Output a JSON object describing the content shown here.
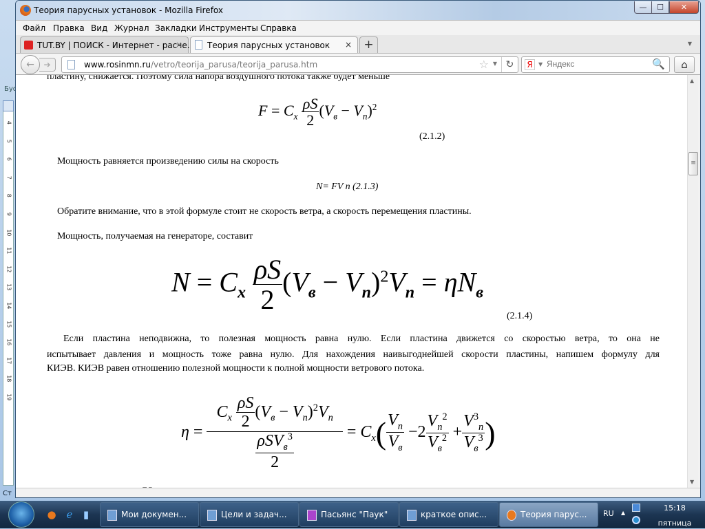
{
  "window": {
    "title": "Теория парусных установок - Mozilla Firefox",
    "minimize": "—",
    "maximize": "☐",
    "close": "✕"
  },
  "menu": [
    "Файл",
    "Правка",
    "Вид",
    "Журнал",
    "Закладки",
    "Инструменты",
    "Справка"
  ],
  "tabs": [
    {
      "label": "TUT.BY | ПОИСК - Интернет - расче...",
      "close": "×"
    },
    {
      "label": "Теория парусных установок",
      "close": "×"
    }
  ],
  "new_tab": "+",
  "nav": {
    "url_host": "www.rosinmn.ru",
    "url_path": "/vetro/teorija_parusa/teorija_parusa.htm",
    "search_placeholder": "Яндекс",
    "search_engine_logo": "Я"
  },
  "word_bg": {
    "ribbon_label": "Буф",
    "status_label": "Ст",
    "ruler": [
      "4",
      "5",
      "6",
      "7",
      "8",
      "9",
      "10",
      "11",
      "12",
      "13",
      "14",
      "15",
      "16",
      "17",
      "18",
      "19"
    ]
  },
  "article": {
    "line_top": "пластину, снижается. Поэтому сила напора воздушного потока также будет меньше",
    "eq_212_label": "(2.1.2)",
    "para_power": "Мощность равняется произведению силы на скорость",
    "eq_213": "N= FV n (2.1.3)",
    "para_note": "Обратите внимание, что в этой формуле стоит не скорость ветра, а скорость перемещения пластины.",
    "para_gen": "Мощность, получаемая на генераторе, составит",
    "eq_214_label": "(2.1.4)",
    "para_long": [
      "Если пластина неподвижна, то полезная мощность равна нулю. Если пластина движется со скоростью ветра, то она не",
      "испытывает давления и мощность тоже равна нулю. Для нахождения наивыгоднейшей скорости пластины, напишем формулу для",
      "КИЭВ. КИЭВ равен отношению полезной мощности к полной мощности ветрового потока."
    ],
    "eq": {
      "F": "F",
      "N": "N",
      "eta": "η",
      "C": "C",
      "x": "x",
      "rhoS": "ρS",
      "two": "2",
      "V": "V",
      "v": "в",
      "n": "n",
      "sq": "2",
      "cube": "3",
      "eq": "=",
      "minus": "−",
      "plus": "+",
      "lp": "(",
      "rp": ")",
      "Nv": "N",
      "rhoSV": "ρSV",
      "K": "К"
    }
  },
  "taskbar": {
    "tasks": [
      "Мои докумен...",
      "Цели и задач...",
      "Пасьянс \"Паук\"",
      "краткое опис...",
      "Теория парус..."
    ],
    "lang": "RU",
    "time": "15:18",
    "day": "пятница"
  }
}
